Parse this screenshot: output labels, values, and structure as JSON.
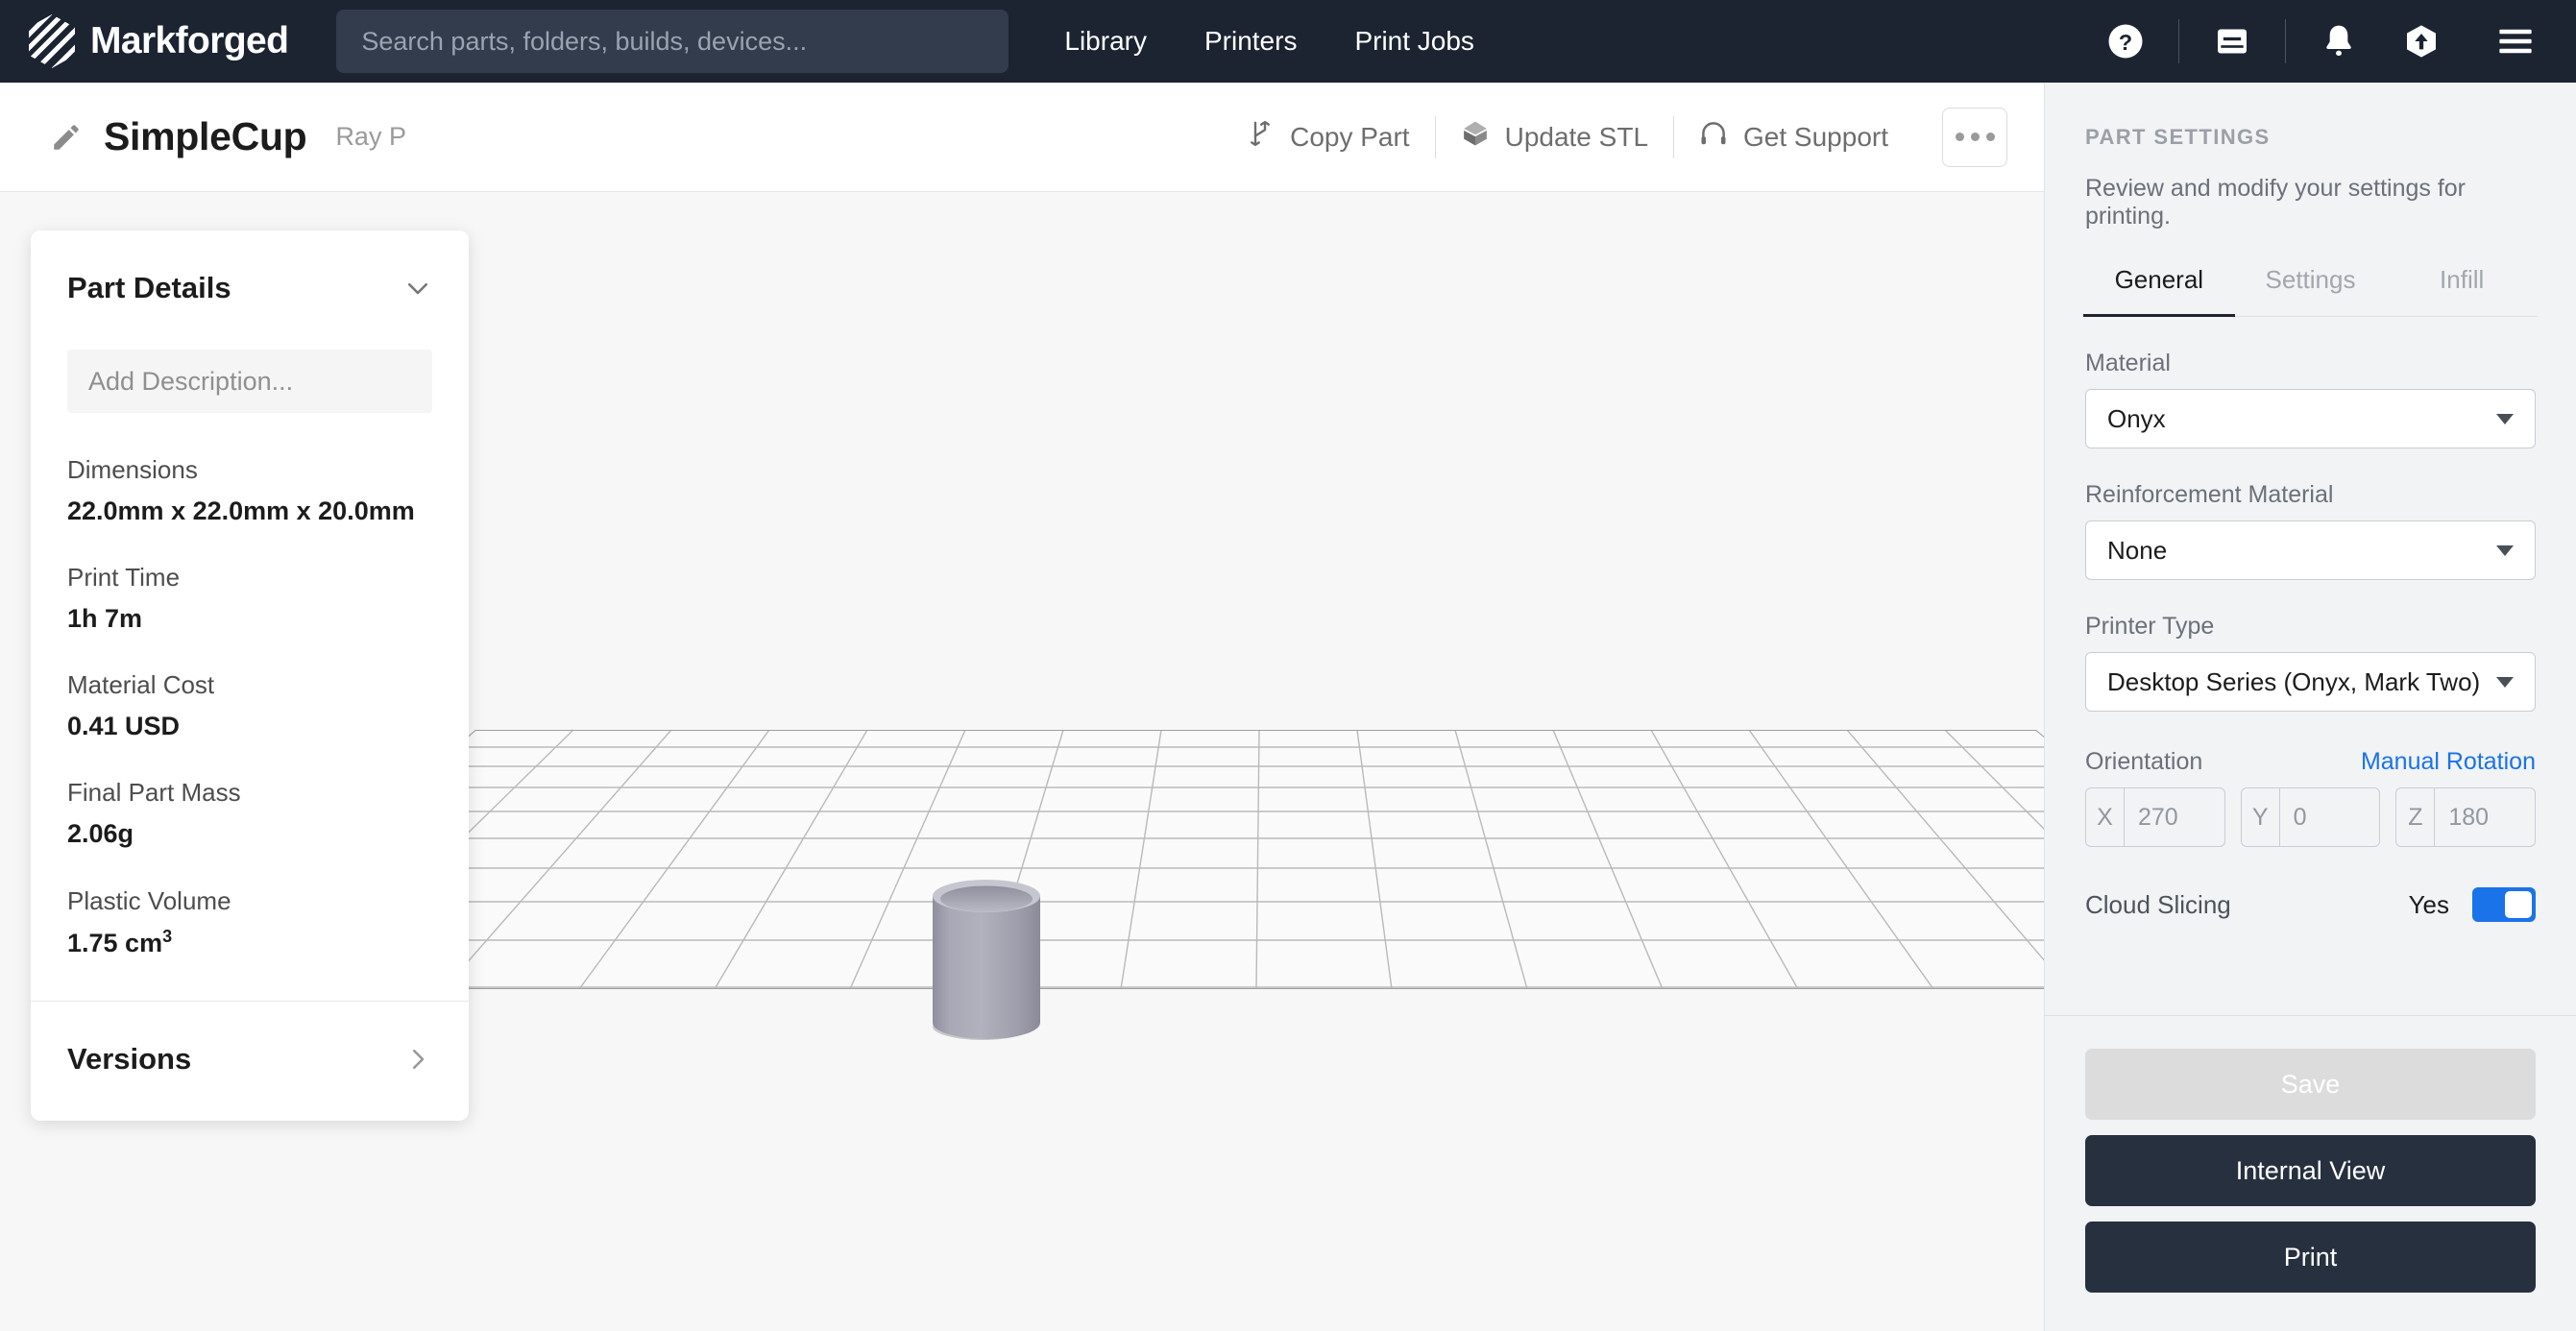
{
  "topnav": {
    "brand": "Markforged",
    "logo_icon": "markforged-hex-logo",
    "search": {
      "value": "",
      "placeholder": "Search parts, folders, builds, devices..."
    },
    "links": [
      {
        "label": "Library"
      },
      {
        "label": "Printers"
      },
      {
        "label": "Print Jobs"
      }
    ],
    "icons": [
      {
        "name": "help-icon"
      },
      {
        "name": "inbox-icon"
      },
      {
        "name": "bell-icon"
      },
      {
        "name": "upload-icon"
      },
      {
        "name": "hamburger-menu-icon"
      }
    ]
  },
  "subheader": {
    "edit_icon": "pencil-icon",
    "title": "SimpleCup",
    "owner": "Ray P",
    "actions": [
      {
        "label": "Copy Part",
        "icon": "branch-icon"
      },
      {
        "label": "Update STL",
        "icon": "cube-icon"
      },
      {
        "label": "Get Support",
        "icon": "headset-icon"
      }
    ],
    "more_label": "More options"
  },
  "part_details": {
    "title": "Part Details",
    "collapse_icon": "chevron-down-icon",
    "description_placeholder": "Add Description...",
    "description_value": "",
    "rows": [
      {
        "label": "Dimensions",
        "value": "22.0mm x 22.0mm x 20.0mm"
      },
      {
        "label": "Print Time",
        "value": "1h 7m"
      },
      {
        "label": "Material Cost",
        "value": "0.41 USD"
      },
      {
        "label": "Final Part Mass",
        "value": "2.06g"
      },
      {
        "label": "Plastic Volume",
        "value": "1.75 cm",
        "sup": "3"
      }
    ],
    "versions_label": "Versions",
    "versions_icon": "chevron-right-icon"
  },
  "viewport": {
    "model_name": "simple-cup-3d-model",
    "build_plate": "build-plate-grid"
  },
  "part_settings": {
    "kicker": "PART SETTINGS",
    "subtitle": "Review and modify your settings for printing.",
    "tabs": [
      {
        "label": "General",
        "active": true
      },
      {
        "label": "Settings",
        "active": false
      },
      {
        "label": "Infill",
        "active": false
      }
    ],
    "material": {
      "label": "Material",
      "value": "Onyx"
    },
    "reinforcement": {
      "label": "Reinforcement Material",
      "value": "None"
    },
    "printer_type": {
      "label": "Printer Type",
      "value": "Desktop Series (Onyx, Mark Two)"
    },
    "orientation": {
      "label": "Orientation",
      "manual_rotation": "Manual Rotation",
      "axes": [
        {
          "axis": "X",
          "value": "270"
        },
        {
          "axis": "Y",
          "value": "0"
        },
        {
          "axis": "Z",
          "value": "180"
        }
      ]
    },
    "cloud_slicing": {
      "label": "Cloud Slicing",
      "state_label": "Yes",
      "enabled": true
    },
    "buttons": {
      "save": "Save",
      "internal_view": "Internal View",
      "print": "Print"
    }
  },
  "colors": {
    "nav_bg": "#1c2331",
    "accent_blue": "#1a73e8",
    "dark_button": "#26303f",
    "panel_bg": "#f1f3f5",
    "viewport_bg": "#f7f7f7"
  }
}
